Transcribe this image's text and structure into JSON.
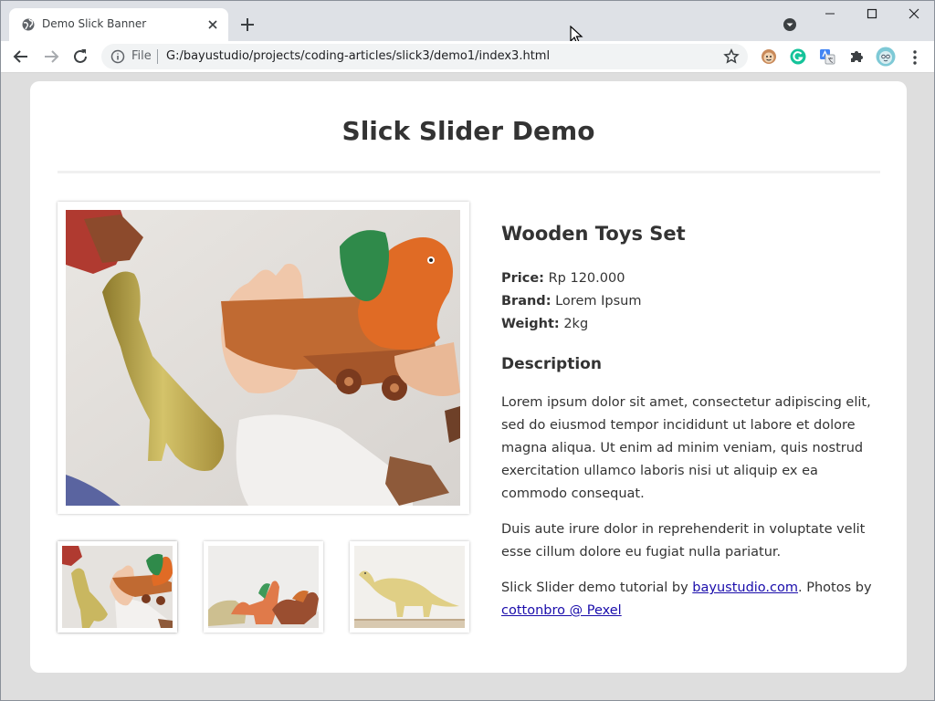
{
  "browser": {
    "tab_title": "Demo Slick Banner",
    "scheme_label": "File",
    "url": "G:/bayustudio/projects/coding-articles/slick3/demo1/index3.html"
  },
  "page": {
    "title": "Slick Slider Demo",
    "product": {
      "name": "Wooden Toys Set",
      "price_label": "Price:",
      "price_value": "Rp 120.000",
      "brand_label": "Brand:",
      "brand_value": "Lorem Ipsum",
      "weight_label": "Weight:",
      "weight_value": "2kg"
    },
    "description_heading": "Description",
    "description_p1": "Lorem ipsum dolor sit amet, consectetur adipiscing elit, sed do eiusmod tempor incididunt ut labore et dolore magna aliqua. Ut enim ad minim veniam, quis nostrud exercitation ullamco laboris nisi ut aliquip ex ea commodo consequat.",
    "description_p2": "Duis aute irure dolor in reprehenderit in voluptate velit esse cillum dolore eu fugiat nulla pariatur.",
    "credit_prefix": "Slick Slider demo tutorial by ",
    "credit_link1": "bayustudio.com",
    "credit_middle": ". Photos by ",
    "credit_link2": "cottonbro @ Pexel"
  },
  "colors": {
    "accent_link": "#1a0dab",
    "page_bg": "#dedede",
    "card_bg": "#ffffff"
  }
}
